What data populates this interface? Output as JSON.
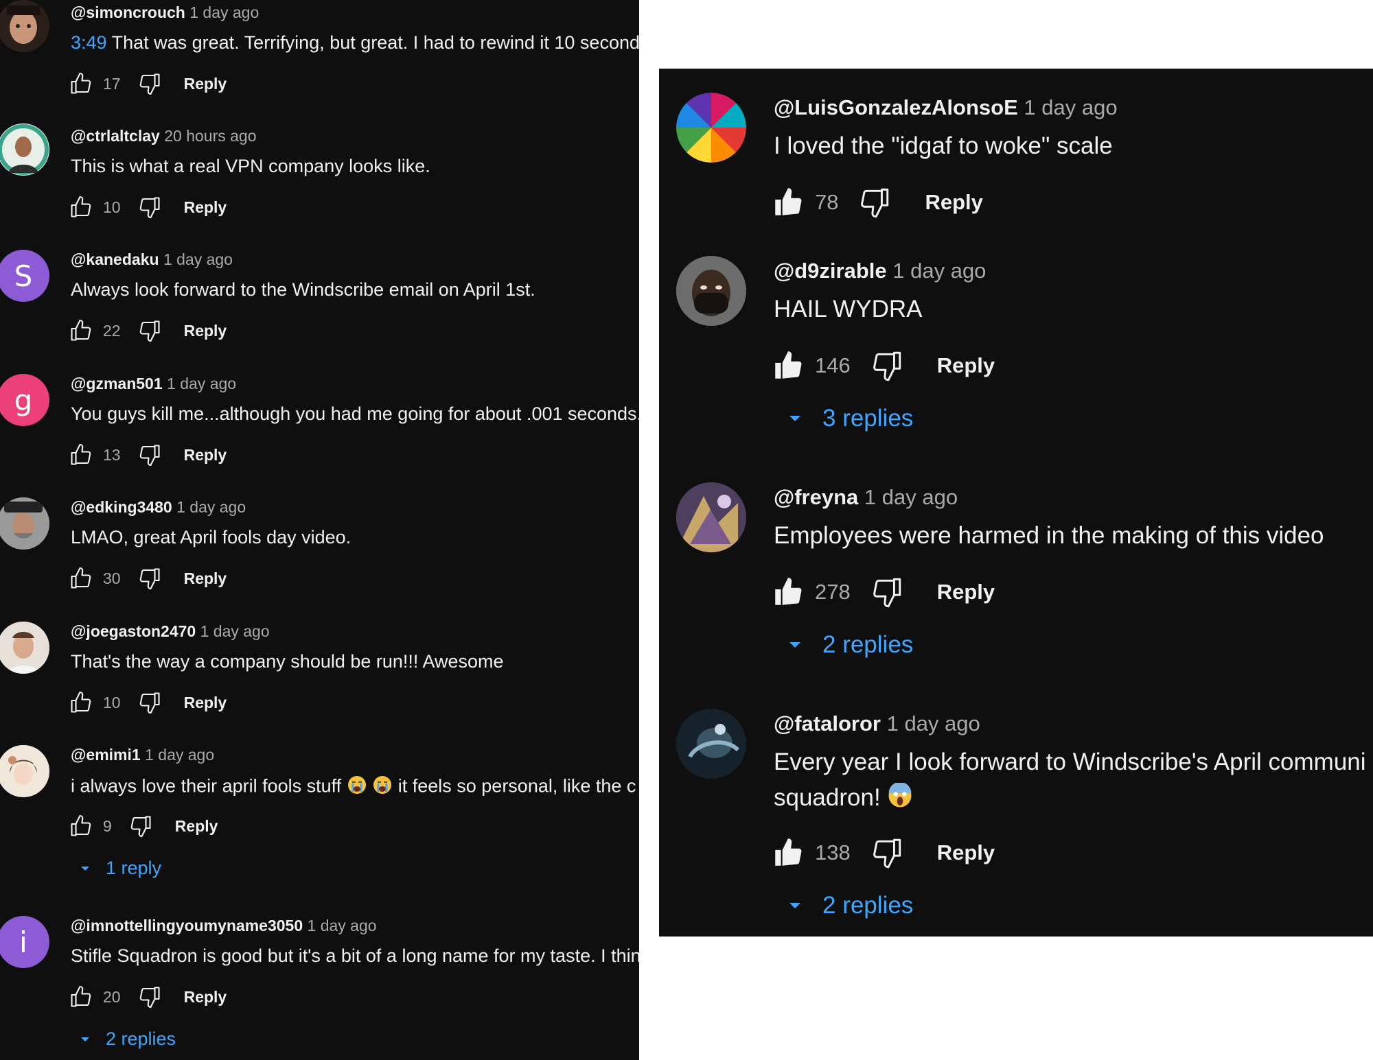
{
  "left_panel": {
    "comments": [
      {
        "author": "@simoncrouch",
        "time": "1 day ago",
        "timestamp_link": "3:49",
        "text": "That was great. Terrifying, but great.  I had to rewind it 10 second",
        "likes": "17",
        "reply_label": "Reply",
        "avatar_icon": "photo-avatar-icon"
      },
      {
        "author": "@ctrlaltclay",
        "time": "20 hours ago",
        "text": "This is what a real VPN company looks like.",
        "likes": "10",
        "reply_label": "Reply",
        "avatar_icon": "photo-avatar-icon"
      },
      {
        "author": "@kanedaku",
        "time": "1 day ago",
        "text": "Always look forward to the Windscribe email on April 1st.",
        "likes": "22",
        "reply_label": "Reply",
        "avatar_letter": "S",
        "avatar_color": "#8e5bd6"
      },
      {
        "author": "@gzman501",
        "time": "1 day ago",
        "text": "You guys kill me...although you had me going for about .001 seconds.",
        "likes": "13",
        "reply_label": "Reply",
        "avatar_letter": "g",
        "avatar_color": "#ec407a"
      },
      {
        "author": "@edking3480",
        "time": "1 day ago",
        "text": "LMAO, great April fools day video.",
        "likes": "30",
        "reply_label": "Reply",
        "avatar_icon": "photo-avatar-icon"
      },
      {
        "author": "@joegaston2470",
        "time": "1 day ago",
        "text": "That's the way a company should be run!!! Awesome",
        "likes": "10",
        "reply_label": "Reply",
        "avatar_icon": "photo-avatar-icon"
      },
      {
        "author": "@emimi1",
        "time": "1 day ago",
        "text_before": "i always love their april fools stuff",
        "text_after": "it feels so personal, like the c",
        "emoji": "loudly-crying-face",
        "likes": "9",
        "reply_label": "Reply",
        "replies_label": "1 reply",
        "avatar_icon": "photo-avatar-icon"
      },
      {
        "author": "@imnottellingyoumyname3050",
        "time": "1 day ago",
        "text": "Stifle Squadron is good but it's a bit of a long name for my taste. I thin",
        "likes": "20",
        "reply_label": "Reply",
        "replies_label": "2 replies",
        "avatar_letter": "i",
        "avatar_color": "#8e5bd6"
      }
    ]
  },
  "right_panel": {
    "comments": [
      {
        "author": "@LuisGonzalezAlonsoE",
        "time": "1 day ago",
        "text": "I loved the \"idgaf to woke\" scale",
        "likes": "78",
        "reply_label": "Reply",
        "avatar_icon": "pinwheel-avatar-icon"
      },
      {
        "author": "@d9zirable",
        "time": "1 day ago",
        "text": "HAIL WYDRA",
        "likes": "146",
        "reply_label": "Reply",
        "replies_label": "3 replies",
        "avatar_icon": "photo-avatar-icon"
      },
      {
        "author": "@freyna",
        "time": "1 day ago",
        "text": "Employees were harmed in the making of this video",
        "likes": "278",
        "reply_label": "Reply",
        "replies_label": "2 replies",
        "avatar_icon": "photo-avatar-icon"
      },
      {
        "author": "@fataloror",
        "time": "1 day ago",
        "text_line1": "Every year I look forward to Windscribe's April communi",
        "text_line2": "squadron!",
        "emoji": "face-screaming-in-fear",
        "likes": "138",
        "reply_label": "Reply",
        "replies_label": "2 replies",
        "avatar_icon": "photo-avatar-icon"
      }
    ]
  },
  "colors": {
    "background": "#0f0f0f",
    "text": "#f1f1f1",
    "secondary_text": "#aaaaaa",
    "link_blue": "#3ea6ff"
  }
}
